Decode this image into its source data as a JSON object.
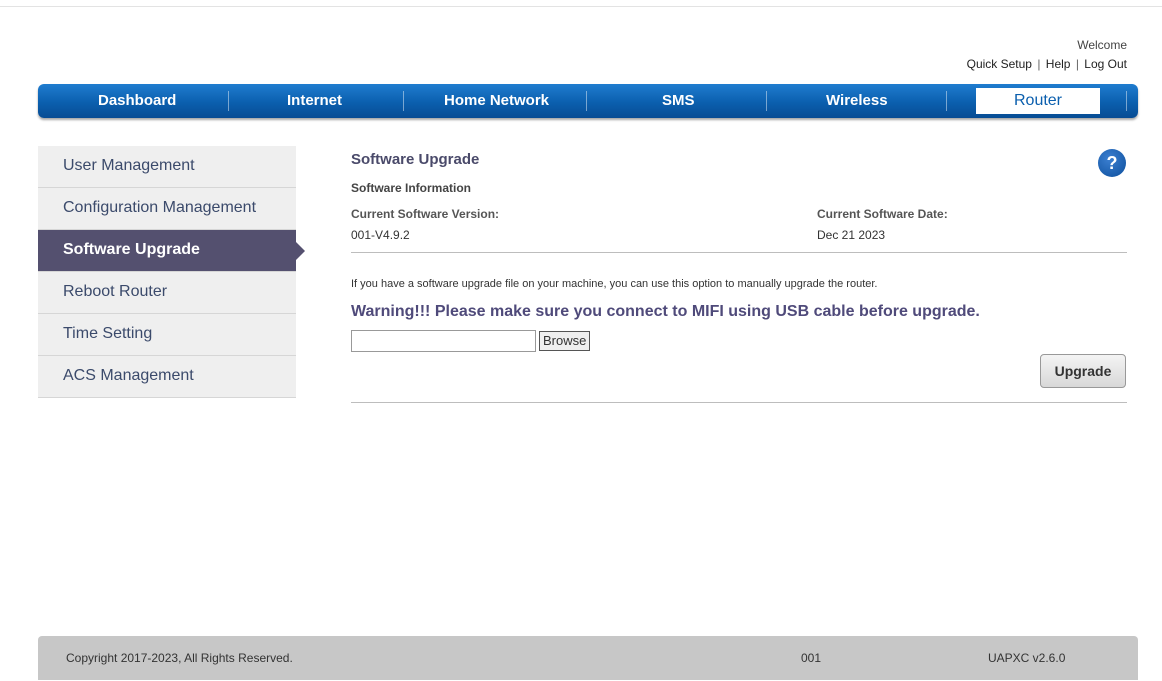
{
  "header": {
    "welcome": "Welcome",
    "links": {
      "quick_setup": "Quick Setup",
      "separator": "|",
      "help": "Help",
      "logout": "Log Out"
    }
  },
  "nav": {
    "items": [
      "Dashboard",
      "Internet",
      "Home Network",
      "SMS",
      "Wireless",
      "Router"
    ],
    "active": "Router"
  },
  "sidebar": {
    "items": [
      "User Management",
      "Configuration Management",
      "Software Upgrade",
      "Reboot Router",
      "Time Setting",
      "ACS Management"
    ],
    "active": "Software Upgrade"
  },
  "main": {
    "title": "Software Upgrade",
    "help_icon": "?",
    "section_title": "Software Information",
    "version_label": "Current Software Version:",
    "version_value": "001-V4.9.2",
    "date_label": "Current Software Date:",
    "date_value": "Dec 21 2023",
    "info": "If you have a software upgrade file on your machine, you can use this option to manually upgrade the router.",
    "warning": "Warning!!! Please make sure you connect to MIFI using USB cable before upgrade.",
    "file_value": "",
    "browse_label": "Browse",
    "upgrade_label": "Upgrade"
  },
  "footer": {
    "copyright": "Copyright 2017-2023, All Rights Reserved.",
    "code": "001",
    "version": "UAPXC v2.6.0"
  },
  "colors": {
    "nav_blue": "#0b5fae",
    "sidebar_active": "#54506f",
    "footer_gray": "#c7c7c7"
  }
}
